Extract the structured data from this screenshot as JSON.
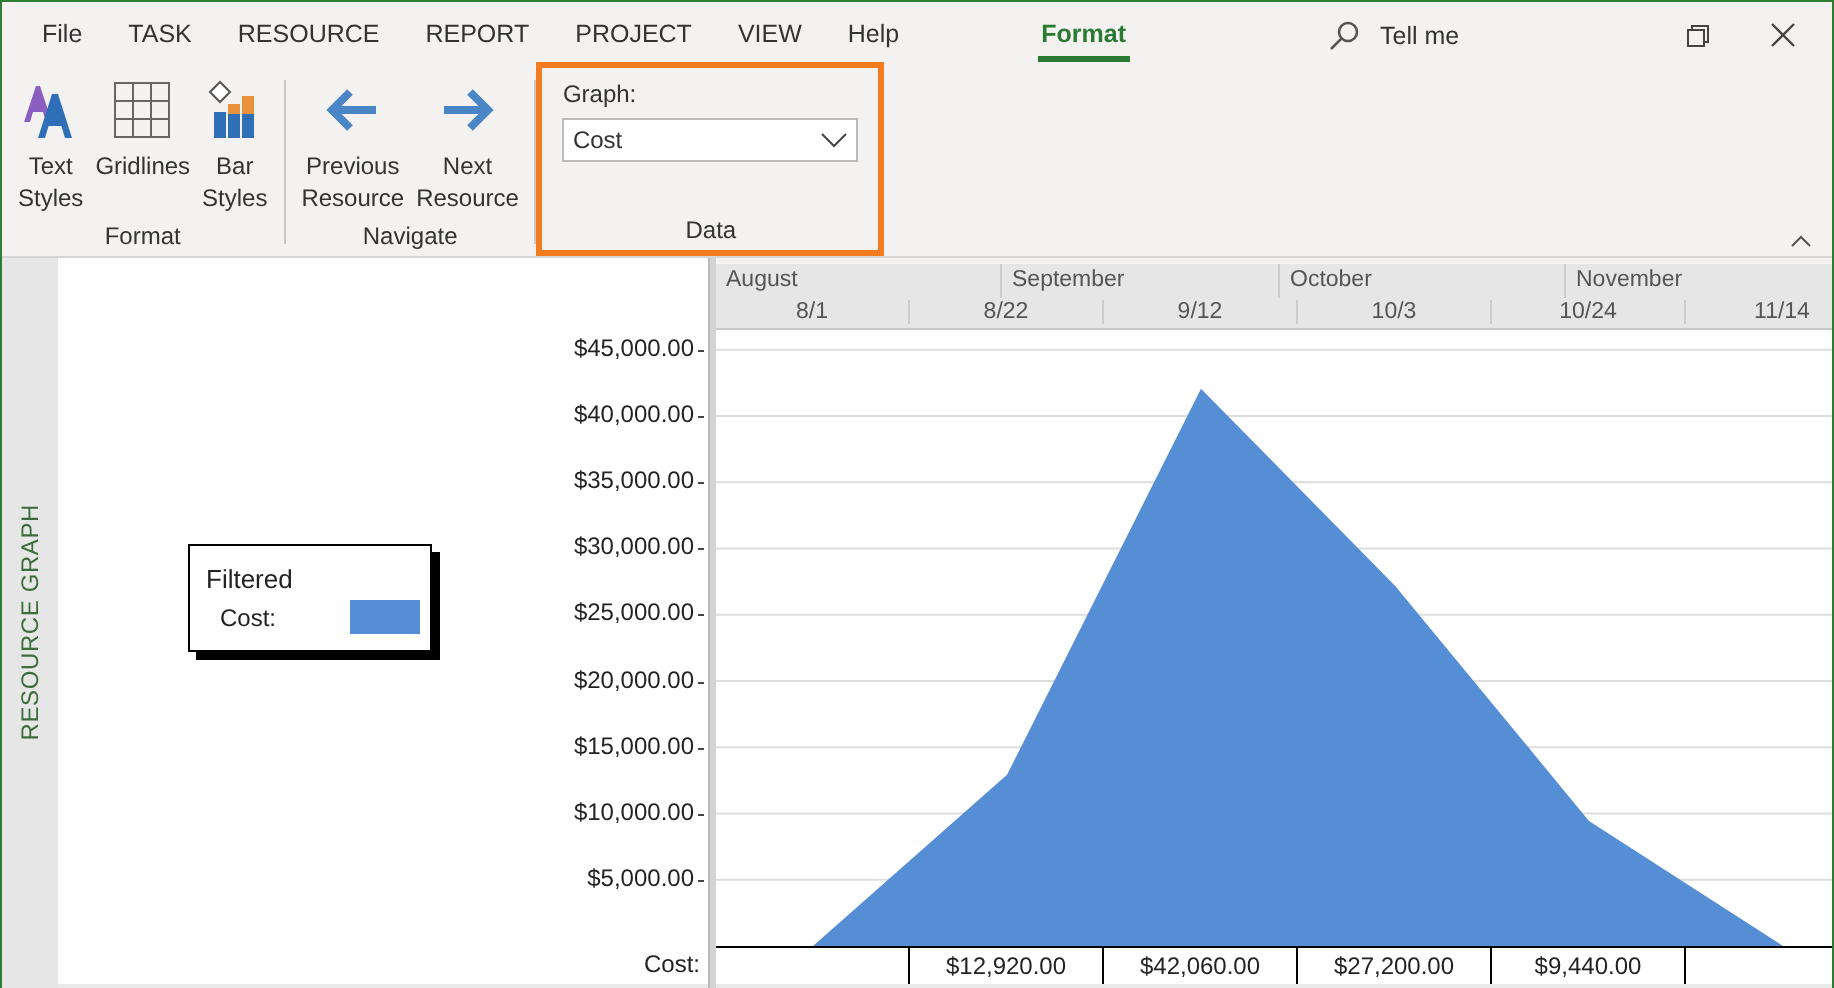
{
  "menu": {
    "tabs": [
      {
        "label": "File",
        "selected": false
      },
      {
        "label": "TASK",
        "selected": false
      },
      {
        "label": "RESOURCE",
        "selected": false
      },
      {
        "label": "REPORT",
        "selected": false
      },
      {
        "label": "PROJECT",
        "selected": false
      },
      {
        "label": "VIEW",
        "selected": false
      },
      {
        "label": "Help",
        "selected": false
      },
      {
        "label": "Format",
        "selected": true
      }
    ],
    "search": {
      "label": "Tell me"
    }
  },
  "ribbon": {
    "groups": [
      {
        "label": "Format",
        "kind": "buttons",
        "highlighted": false,
        "buttons": [
          "Text Styles",
          "Gridlines",
          "Bar Styles"
        ]
      },
      {
        "label": "Navigate",
        "kind": "buttons",
        "highlighted": false,
        "buttons": [
          "Previous Resource",
          "Next Resource"
        ]
      },
      {
        "label": "Data",
        "kind": "field",
        "highlighted": true,
        "field_label": "Graph:",
        "value": "Cost"
      }
    ]
  },
  "view_label": "RESOURCE GRAPH",
  "legend": {
    "title": "Filtered",
    "items": [
      {
        "label": "Cost:",
        "color": "#558ed5"
      }
    ]
  },
  "timescale": {
    "months": [
      "August",
      "September",
      "October",
      "November"
    ]
  },
  "graph": {
    "row_label": "Cost:",
    "chart_data": {
      "type": "area",
      "categories": [
        "8/1",
        "8/22",
        "9/12",
        "10/3",
        "10/24",
        "11/14"
      ],
      "series": [
        {
          "color": "#558ed5",
          "values": [
            0,
            12920,
            42060,
            27200,
            9440,
            0
          ]
        }
      ],
      "ylim": [
        0,
        46500
      ],
      "grid": true,
      "yticks": [
        {
          "value": 5000,
          "label": "$5,000.00"
        },
        {
          "value": 10000,
          "label": "$10,000.00"
        },
        {
          "value": 15000,
          "label": "$15,000.00"
        },
        {
          "value": 20000,
          "label": "$20,000.00"
        },
        {
          "value": 25000,
          "label": "$25,000.00"
        },
        {
          "value": 30000,
          "label": "$30,000.00"
        },
        {
          "value": 35000,
          "label": "$35,000.00"
        },
        {
          "value": 40000,
          "label": "$40,000.00"
        },
        {
          "value": 45000,
          "label": "$45,000.00"
        }
      ],
      "value_labels": [
        null,
        "$12,920.00",
        "$42,060.00",
        "$27,200.00",
        "$9,440.00",
        null
      ]
    }
  }
}
